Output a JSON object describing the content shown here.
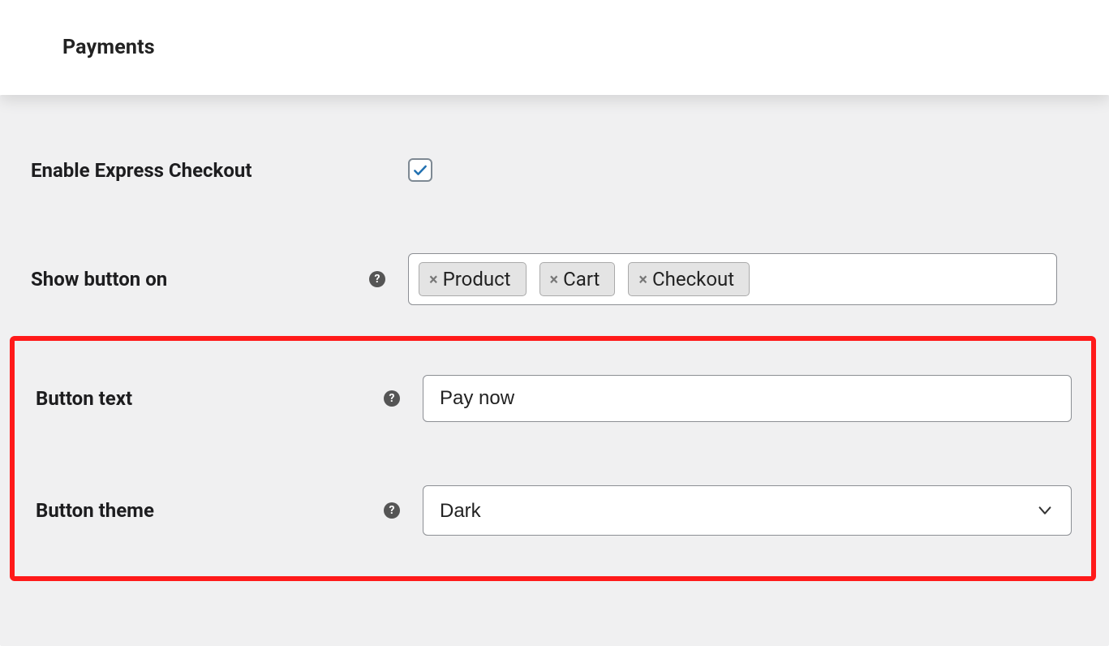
{
  "header": {
    "title": "Payments"
  },
  "settings": {
    "enable_express_checkout": {
      "label": "Enable Express Checkout",
      "checked": true
    },
    "show_button_on": {
      "label": "Show button on",
      "tags": [
        "Product",
        "Cart",
        "Checkout"
      ]
    },
    "button_text": {
      "label": "Button text",
      "value": "Pay now"
    },
    "button_theme": {
      "label": "Button theme",
      "value": "Dark"
    }
  }
}
